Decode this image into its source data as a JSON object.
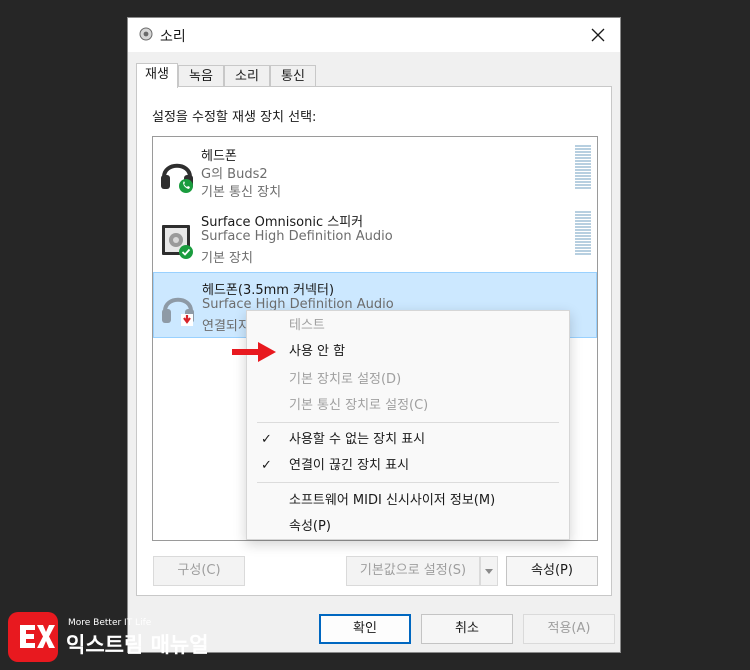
{
  "window": {
    "title": "소리",
    "close_glyph": "✕"
  },
  "tabs": [
    {
      "label": "재생",
      "active": true
    },
    {
      "label": "녹음",
      "active": false
    },
    {
      "label": "소리",
      "active": false
    },
    {
      "label": "통신",
      "active": false
    }
  ],
  "instruction": "설정을 수정할 재생 장치 선택:",
  "devices": [
    {
      "name": "헤드폰",
      "desc": "G의 Buds2",
      "status": "기본 통신 장치",
      "icon": "headphones-icon",
      "badge": "phone-badge-icon"
    },
    {
      "name": "Surface Omnisonic 스피커",
      "desc": "Surface High Definition Audio",
      "status": "기본 장치",
      "icon": "speaker-icon",
      "badge": "check-badge-icon"
    },
    {
      "name": "헤드폰(3.5mm 커넥터)",
      "desc": "Surface High Definition Audio",
      "status": "연결되지",
      "icon": "headphones-icon",
      "badge": "unplugged-badge-icon",
      "selected": true
    }
  ],
  "context_menu": {
    "items": [
      {
        "label": "테스트",
        "enabled": false,
        "checked": false
      },
      {
        "label": "사용 안 함",
        "enabled": true,
        "checked": false
      },
      {
        "label": "기본 장치로 설정(D)",
        "enabled": false,
        "checked": false
      },
      {
        "label": "기본 통신 장치로 설정(C)",
        "enabled": false,
        "checked": false
      },
      {
        "label": "사용할 수 없는 장치 표시",
        "enabled": true,
        "checked": true
      },
      {
        "label": "연결이 끊긴 장치 표시",
        "enabled": true,
        "checked": true
      },
      {
        "label": "소프트웨어 MIDI 신시사이저 정보(M)",
        "enabled": true,
        "checked": false
      },
      {
        "label": "속성(P)",
        "enabled": true,
        "checked": false
      }
    ],
    "check_glyph": "✓"
  },
  "buttons": {
    "configure": "구성(C)",
    "set_default": "기본값으로 설정(S)",
    "properties": "속성(P)",
    "ok": "확인",
    "cancel": "취소",
    "apply": "적용(A)"
  },
  "watermark": {
    "small": "More Better IT Life",
    "big": "익스트림 매뉴얼"
  },
  "colors": {
    "accent": "#0067c0",
    "selection": "#cce8ff",
    "arrow": "#e8191f",
    "green": "#1a9c3e",
    "red": "#d8232a"
  }
}
